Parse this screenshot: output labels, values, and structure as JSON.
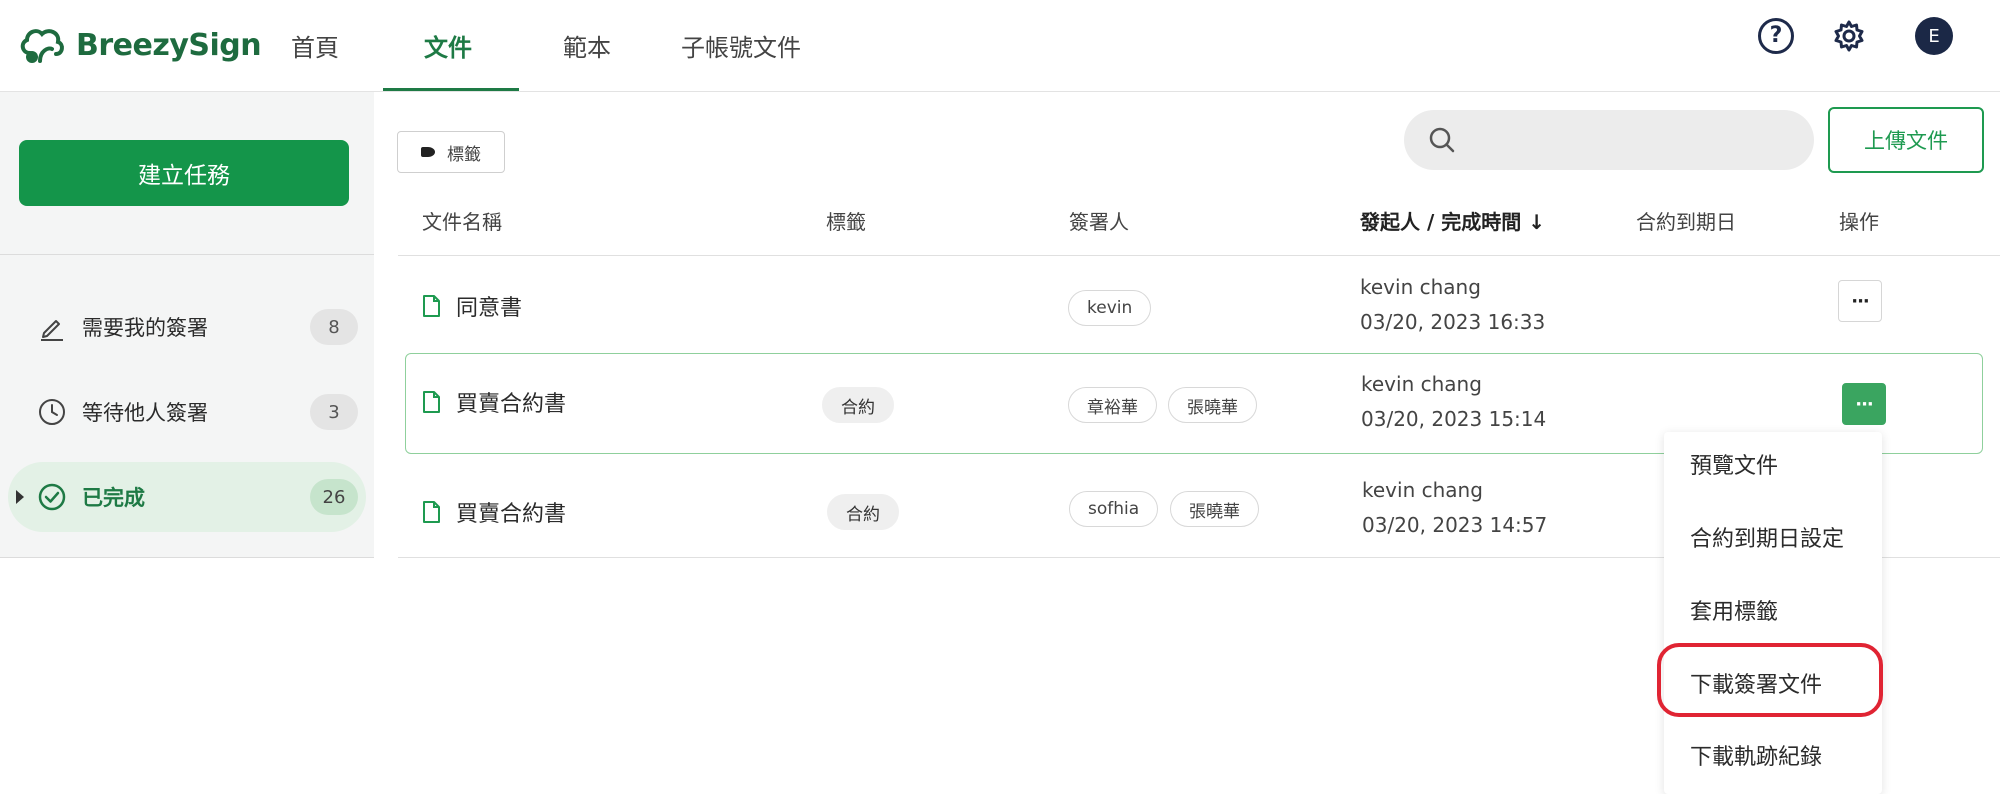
{
  "app": {
    "brand": "BreezySign",
    "brand_color": "#1e7a45"
  },
  "nav": {
    "tabs": [
      {
        "label": "首頁"
      },
      {
        "label": "文件",
        "active": true
      },
      {
        "label": "範本"
      },
      {
        "label": "子帳號文件"
      }
    ]
  },
  "header": {
    "avatar_initial": "E",
    "help_icon": "help-circle-icon",
    "settings_icon": "gear-icon"
  },
  "sidebar": {
    "create_label": "建立任務",
    "items": [
      {
        "label": "需要我的簽署",
        "count": "8",
        "icon": "pen-icon"
      },
      {
        "label": "等待他人簽署",
        "count": "3",
        "icon": "clock-icon"
      },
      {
        "label": "已完成",
        "count": "26",
        "icon": "check-circle-icon",
        "active": true
      }
    ]
  },
  "toolbar": {
    "tag_filter_label": "標籤",
    "search_placeholder": "",
    "upload_label": "上傳文件"
  },
  "table": {
    "columns": [
      "文件名稱",
      "標籤",
      "簽署人",
      "發起人 / 完成時間",
      "合約到期日",
      "操作"
    ],
    "sort_arrow": "↓",
    "rows": [
      {
        "name": "同意書",
        "tags": [],
        "signers": [
          "kevin"
        ],
        "sender": "kevin chang",
        "time": "03/20, 2023 16:33",
        "expiry": ""
      },
      {
        "name": "買賣合約書",
        "tags": [
          "合約"
        ],
        "signers": [
          "章裕華",
          "張曉華"
        ],
        "sender": "kevin chang",
        "time": "03/20, 2023 15:14",
        "expiry": ""
      },
      {
        "name": "買賣合約書",
        "tags": [
          "合約"
        ],
        "signers": [
          "sofhia",
          "張曉華"
        ],
        "sender": "kevin chang",
        "time": "03/20, 2023 14:57",
        "expiry": ""
      }
    ],
    "more_label": "···"
  },
  "dropdown": {
    "items": [
      "預覽文件",
      "合約到期日設定",
      "套用標籤",
      "下載簽署文件",
      "下載軌跡紀錄"
    ],
    "highlighted": "下載簽署文件",
    "highlight_color": "#e02433"
  }
}
